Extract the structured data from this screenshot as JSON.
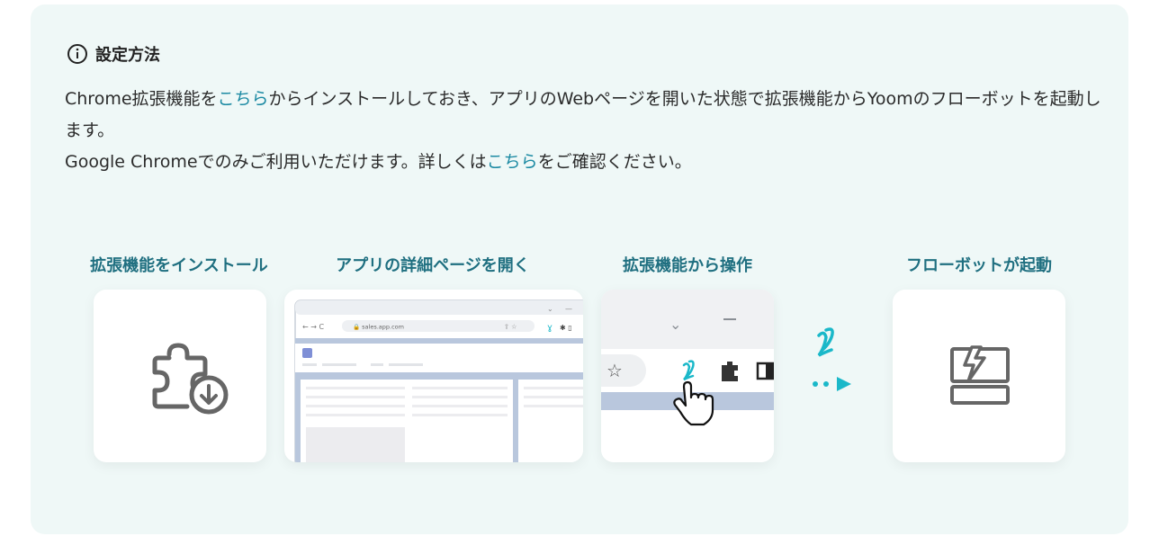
{
  "heading": {
    "title": "設定方法",
    "icon": "info-icon"
  },
  "description": {
    "line1_prefix": "Chrome拡張機能を",
    "line1_link": "こちら",
    "line1_suffix": "からインストールしておき、アプリのWebページを開いた状態で拡張機能からYoomのフローボットを起動します。",
    "line2_prefix": "Google Chromeでのみご利用いただけます。詳しくは",
    "line2_link": "こちら",
    "line2_suffix": "をご確認ください。"
  },
  "steps": [
    {
      "title": "拡張機能をインストール",
      "icon": "puzzle-download-icon"
    },
    {
      "title": "アプリの詳細ページを開く",
      "icon": "browser-window-icon",
      "url": "sales.app.com"
    },
    {
      "title": "拡張機能から操作",
      "icon": "extension-toolbar-icon"
    },
    {
      "title": "フローボットが起動",
      "icon": "flowbot-launch-icon"
    }
  ],
  "arrow": {
    "icon": "yoom-logo-arrow-icon"
  },
  "colors": {
    "panel_bg": "#eff8f7",
    "accent": "#1f6f80",
    "link": "#1c8aa3",
    "logo": "#1ab8c9"
  }
}
